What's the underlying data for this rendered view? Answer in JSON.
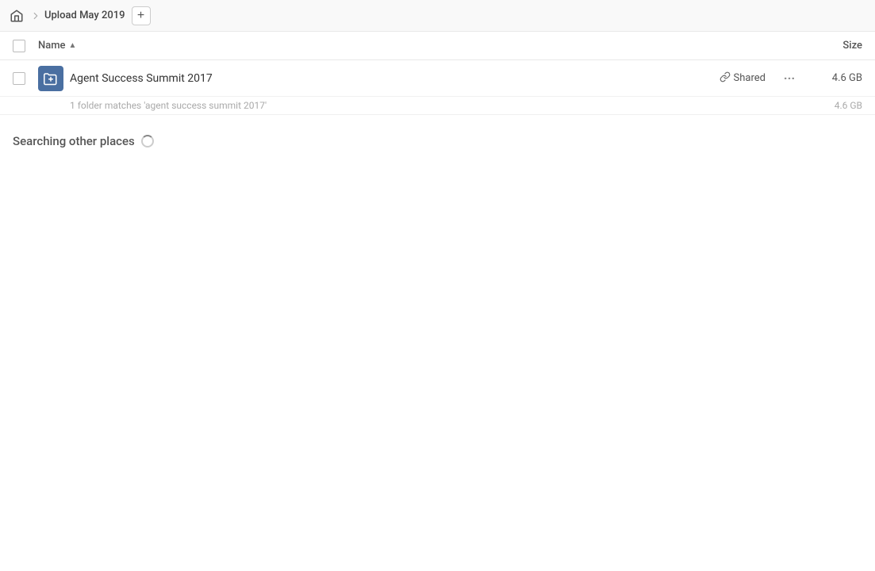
{
  "breadcrumb": {
    "home_label": "home",
    "title": "Upload May 2019",
    "add_button_label": "+"
  },
  "column_headers": {
    "name_label": "Name",
    "sort_indicator": "▲",
    "size_label": "Size"
  },
  "files": [
    {
      "id": "agent-success-summit",
      "name": "Agent Success Summit 2017",
      "shared_label": "Shared",
      "size": "4.6 GB",
      "sub_match": "1 folder matches 'agent success summit 2017'",
      "sub_match_size": "4.6 GB"
    }
  ],
  "searching_section": {
    "label": "Searching other places"
  },
  "colors": {
    "folder_bg": "#4a6fa1",
    "accent": "#4a6fa1"
  }
}
